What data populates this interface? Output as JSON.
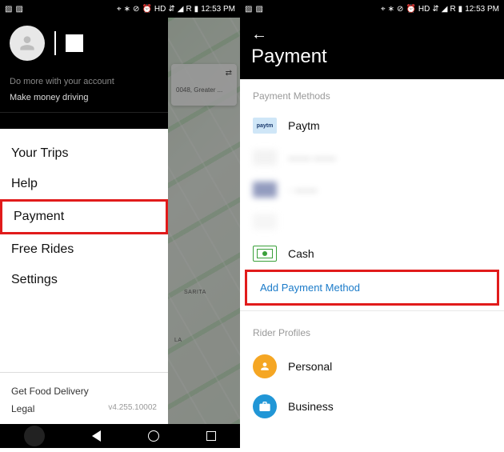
{
  "status": {
    "left_icons": [
      "image-icon",
      "image-icon"
    ],
    "right_icons": [
      "location-icon",
      "bluetooth-icon",
      "dnd-icon",
      "alarm-icon"
    ],
    "hd_label": "HD",
    "network": "R",
    "time": "12:53 PM"
  },
  "left": {
    "motto": "Do more with your account",
    "driver_link": "Make money driving",
    "menu": [
      {
        "label": "Your Trips"
      },
      {
        "label": "Help"
      },
      {
        "label": "Payment"
      },
      {
        "label": "Free Rides"
      },
      {
        "label": "Settings"
      }
    ],
    "footer": {
      "food": "Get Food Delivery",
      "legal": "Legal",
      "version": "v4.255.10002"
    },
    "map": {
      "card_text": "0048, Greater ...",
      "label_sarita": "SARITA",
      "label_la": "LA"
    }
  },
  "right": {
    "title": "Payment",
    "section_methods": "Payment Methods",
    "methods": {
      "paytm": "Paytm",
      "cash": "Cash",
      "hidden1": "—— ——",
      "hidden2": "· ——"
    },
    "add_payment": "Add Payment Method",
    "section_profiles": "Rider Profiles",
    "profiles": {
      "personal": "Personal",
      "business": "Business"
    }
  }
}
